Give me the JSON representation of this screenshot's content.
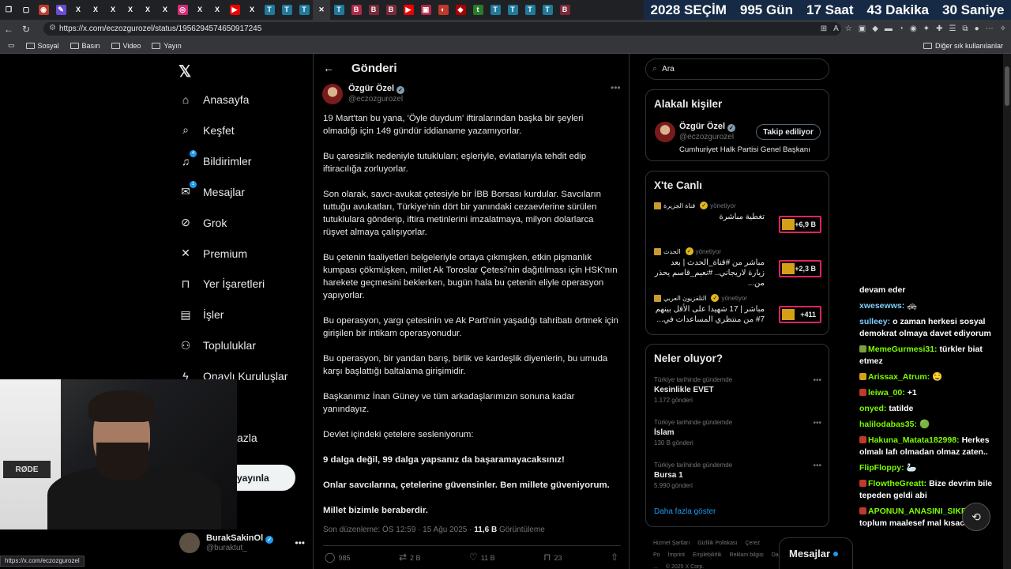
{
  "browser": {
    "tabs": [
      {
        "icon": "tabs-icon",
        "glyph": "❐",
        "bg": "transparent"
      },
      {
        "icon": "window-icon",
        "glyph": "▢",
        "bg": "transparent"
      },
      {
        "icon": "app-icon",
        "glyph": "◉",
        "bg": "#c0392b"
      },
      {
        "icon": "feather-icon",
        "glyph": "✎",
        "bg": "#6a4bd6"
      },
      {
        "icon": "x-icon",
        "glyph": "X",
        "bg": "transparent"
      },
      {
        "icon": "x-icon",
        "glyph": "X",
        "bg": "transparent"
      },
      {
        "icon": "x-icon",
        "glyph": "X",
        "bg": "transparent"
      },
      {
        "icon": "x-icon",
        "glyph": "X",
        "bg": "transparent"
      },
      {
        "icon": "x-icon",
        "glyph": "X",
        "bg": "transparent"
      },
      {
        "icon": "x-icon",
        "glyph": "X",
        "bg": "transparent"
      },
      {
        "icon": "instagram-icon",
        "glyph": "◎",
        "bg": "#d62976"
      },
      {
        "icon": "x-icon",
        "glyph": "X",
        "bg": "transparent"
      },
      {
        "icon": "x-icon",
        "glyph": "X",
        "bg": "transparent"
      },
      {
        "icon": "youtube-icon",
        "glyph": "▶",
        "bg": "#e00"
      },
      {
        "icon": "x-icon",
        "glyph": "X",
        "bg": "transparent"
      },
      {
        "icon": "news-icon",
        "glyph": "T",
        "bg": "#1f7a9b"
      },
      {
        "icon": "news-icon",
        "glyph": "T",
        "bg": "#1f7a9b"
      },
      {
        "icon": "news-icon",
        "glyph": "T",
        "bg": "#1f7a9b"
      },
      {
        "icon": "close-icon",
        "glyph": "✕",
        "bg": "transparent",
        "active": true
      },
      {
        "icon": "news-icon",
        "glyph": "T",
        "bg": "#1f7a9b"
      },
      {
        "icon": "bookmark-icon",
        "glyph": "B",
        "bg": "#b02a4a"
      },
      {
        "icon": "bookmark-icon",
        "glyph": "B",
        "bg": "#7a2a3a"
      },
      {
        "icon": "bookmark-icon",
        "glyph": "B",
        "bg": "#7a2a3a"
      },
      {
        "icon": "youtube-icon",
        "glyph": "▶",
        "bg": "#e00"
      },
      {
        "icon": "news-icon",
        "glyph": "▣",
        "bg": "#b02a4a"
      },
      {
        "icon": "news-icon",
        "glyph": "◐",
        "bg": "#c0392b"
      },
      {
        "icon": "news-icon",
        "glyph": "◆",
        "bg": "#a00"
      },
      {
        "icon": "news-icon",
        "glyph": "t",
        "bg": "#2a7a2a"
      },
      {
        "icon": "news-icon",
        "glyph": "T",
        "bg": "#1f7a9b"
      },
      {
        "icon": "news-icon",
        "glyph": "T",
        "bg": "#1f7a9b"
      },
      {
        "icon": "news-icon",
        "glyph": "T",
        "bg": "#1f7a9b"
      },
      {
        "icon": "news-icon",
        "glyph": "T",
        "bg": "#1f7a9b"
      },
      {
        "icon": "bookmark-icon",
        "glyph": "B",
        "bg": "#7a2a3a"
      }
    ],
    "countdown": [
      "2028 SEÇİM",
      "995 Gün",
      "17 Saat",
      "43 Dakika",
      "30 Saniye"
    ],
    "url": "https://x.com/eczozgurozel/status/1956294574650917245",
    "bookmarks": [
      "Sosyal",
      "Basın",
      "Video",
      "Yayın"
    ],
    "bookmarks_right": "Diğer sık kullanılanlar",
    "status_url": "https://x.com/eczozgurozel"
  },
  "nav": {
    "items": [
      {
        "label": "Anasayfa",
        "icon": "home-icon",
        "glyph": "⌂",
        "badge": ""
      },
      {
        "label": "Keşfet",
        "icon": "search-icon",
        "glyph": "⌕",
        "badge": ""
      },
      {
        "label": "Bildirimler",
        "icon": "bell-icon",
        "glyph": "♫",
        "badge": "4"
      },
      {
        "label": "Mesajlar",
        "icon": "mail-icon",
        "glyph": "✉",
        "badge": "1"
      },
      {
        "label": "Grok",
        "icon": "grok-icon",
        "glyph": "⊘",
        "badge": ""
      },
      {
        "label": "Premium",
        "icon": "x-icon",
        "glyph": "✕",
        "badge": ""
      },
      {
        "label": "Yer İşaretleri",
        "icon": "bookmark-icon",
        "glyph": "⊓",
        "badge": ""
      },
      {
        "label": "İşler",
        "icon": "briefcase-icon",
        "glyph": "▤",
        "badge": ""
      },
      {
        "label": "Topluluklar",
        "icon": "people-icon",
        "glyph": "⚇",
        "badge": ""
      },
      {
        "label": "Onaylı Kuruluşlar",
        "icon": "lightning-icon",
        "glyph": "ϟ",
        "badge": ""
      }
    ],
    "more_partial": "azla",
    "post_partial": "yayınla",
    "account": {
      "name": "BurakSakinOl",
      "handle": "@buraktut_"
    }
  },
  "webcam": {
    "mic_label": "RØDE"
  },
  "post": {
    "header": "Gönderi",
    "author": "Özgür Özel",
    "handle": "@eczozgurozel",
    "paragraphs": [
      {
        "text": "19 Mart'tan bu yana, 'Öyle duydum' iftiralarından başka bir şeyleri olmadığı için 149 gündür iddianame yazamıyorlar.",
        "bold": false
      },
      {
        "text": "Bu çaresizlik nedeniyle tutukluları; eşleriyle, evlatlarıyla tehdit edip iftiracılığa zorluyorlar.",
        "bold": false
      },
      {
        "text": "Son olarak, savcı-avukat çetesiyle bir İBB Borsası kurdular. Savcıların tuttuğu avukatları, Türkiye'nin dört bir yanındaki cezaevlerine sürülen tutuklulara gönderip, iftira metinlerini imzalatmaya, milyon dolarlarca rüşvet almaya çalışıyorlar.",
        "bold": false
      },
      {
        "text": "Bu çetenin faaliyetleri belgeleriyle ortaya çıkmışken, etkin pişmanlık kumpası çökmüşken, millet Ak Toroslar Çetesi'nin dağıtılması için HSK'nın harekete geçmesini beklerken, bugün hala bu çetenin eliyle operasyon yapıyorlar.",
        "bold": false
      },
      {
        "text": "Bu operasyon, yargı çetesinin ve Ak Parti'nin yaşadığı tahribatı örtmek için girişilen bir intikam operasyonudur.",
        "bold": false
      },
      {
        "text": "Bu operasyon, bir yandan barış, birlik ve kardeşlik diyenlerin, bu umuda karşı başlattığı baltalama girişimidir.",
        "bold": false
      },
      {
        "text": "Başkanımız İnan Güney ve tüm arkadaşlarımızın sonuna kadar yanındayız.",
        "bold": false
      },
      {
        "text": "Devlet içindeki çetelere sesleniyorum:",
        "bold": false
      },
      {
        "text": "9 dalga değil, 99 dalga yapsanız da başaramayacaksınız!",
        "bold": true
      },
      {
        "text": "Onlar savcılarına, çetelerine güvensinler. Ben millete güveniyorum.",
        "bold": true
      },
      {
        "text": "Millet bizimle beraberdir.",
        "bold": true
      }
    ],
    "meta_time": "Son düzenleme: ÖS 12:59 · 15 Ağu 2025 · ",
    "meta_views": "11,6 B",
    "meta_views_label": " Görüntüleme",
    "actions": [
      {
        "icon": "reply-icon",
        "glyph": "◯",
        "count": "985"
      },
      {
        "icon": "retweet-icon",
        "glyph": "⇄",
        "count": "2 B"
      },
      {
        "icon": "like-icon",
        "glyph": "♡",
        "count": "11 B"
      },
      {
        "icon": "bookmark-icon",
        "glyph": "⊓",
        "count": "23"
      },
      {
        "icon": "share-icon",
        "glyph": "⇧",
        "count": ""
      }
    ]
  },
  "sidebar": {
    "search_placeholder": "Ara",
    "related": {
      "title": "Alakalı kişiler",
      "name": "Özgür Özel",
      "handle": "@eczozgurozel",
      "bio": "Cumhuriyet Halk Partisi Genel Başkanı",
      "button": "Takip ediliyor"
    },
    "live": {
      "title": "X'te Canlı",
      "items": [
        {
          "source": "قناة الجزيرة",
          "role": "yönetiyor",
          "title": "تغطية مباشرة",
          "count": "+6,9 B"
        },
        {
          "source": "الحدث",
          "role": "yönetiyor",
          "title": "مباشر من #قناة_الحدث | بعد زيارة لاريجاني.. #نعيم_قاسم يحذر من...",
          "count": "+2,3 B"
        },
        {
          "source": "التلفزيون العربي",
          "role": "yönetiyor",
          "title": "مباشر | 17 شهيدا على الأقل بينهم 7# من منتظري المساعدات في...",
          "count": "+411"
        }
      ]
    },
    "trends": {
      "title": "Neler oluyor?",
      "items": [
        {
          "context": "Türkiye tarihinde gündemde",
          "topic": "Kesinlikle EVET",
          "count": "1.172 gönderi"
        },
        {
          "context": "Türkiye tarihinde gündemde",
          "topic": "İslam",
          "count": "130 B gönderi"
        },
        {
          "context": "Türkiye tarihinde gündemde",
          "topic": "Bursa 1",
          "count": "5.990 gönderi"
        }
      ],
      "more": "Daha fazla göster"
    },
    "footer": [
      "Hizmet Şartları",
      "Gizlilik Politikası",
      "Çerez Po",
      "İmprint",
      "Erişilebilirlik",
      "Reklam bilgisi",
      "Daha fazla ...",
      "© 2025 X Corp."
    ],
    "messages": "Mesajlar"
  },
  "chat": [
    {
      "user": "",
      "text": "devam eder",
      "color": "#fff",
      "pre": ""
    },
    {
      "user": "xwesewws:",
      "text": "🚓",
      "color": "#7fd1ff",
      "pre": ""
    },
    {
      "user": "sulleey:",
      "text": "o zaman herkesi sosyal demokrat olmaya davet ediyorum",
      "color": "#7fd1ff",
      "pre": ""
    },
    {
      "user": "MemeGurmesi31:",
      "text": "türkler biat etmez",
      "color": "#7CFC00",
      "pre": "#7aa03a"
    },
    {
      "user": "Arissax_Atrum:",
      "text": "🤤",
      "color": "#7CFC00",
      "pre": "#d4a017"
    },
    {
      "user": "leiwa_00:",
      "text": "+1",
      "color": "#7CFC00",
      "pre": "#c0392b"
    },
    {
      "user": "onyed:",
      "text": "tatilde",
      "color": "#7CFC00",
      "pre": ""
    },
    {
      "user": "halilodabas35:",
      "text": "🟢",
      "color": "#7CFC00",
      "pre": ""
    },
    {
      "user": "Hakuna_Matata182998:",
      "text": "Herkes olmalı lafı olmadan olmaz zaten..",
      "color": "#7CFC00",
      "pre": "#c0392b"
    },
    {
      "user": "FlipFloppy:",
      "text": "🦢",
      "color": "#7CFC00",
      "pre": ""
    },
    {
      "user": "FlowtheGreatt:",
      "text": "Bize devrim bile tepeden geldi abi",
      "color": "#7CFC00",
      "pre": "#c0392b"
    },
    {
      "user": "APONUN_ANASINI_SIKEN:",
      "text": "bu toplum maalesef mal kısacası",
      "color": "#7CFC00",
      "pre": "#c0392b"
    }
  ]
}
